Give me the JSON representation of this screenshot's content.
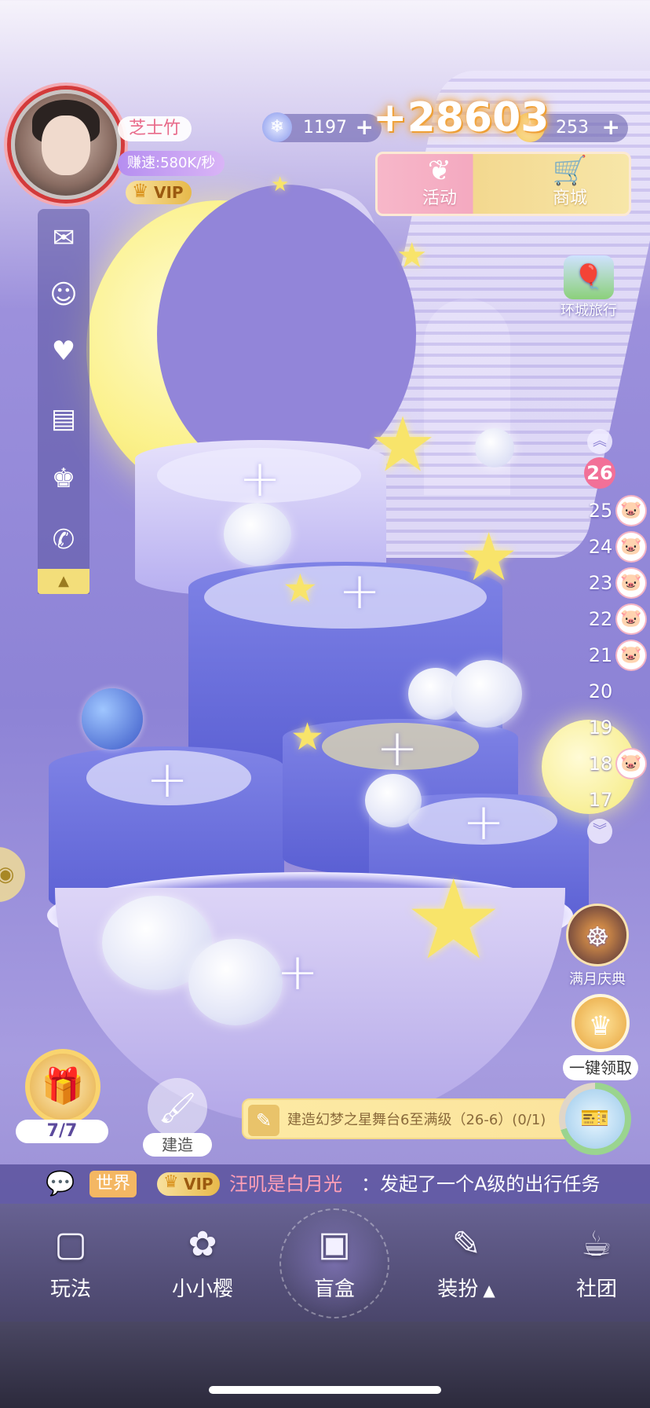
{
  "profile": {
    "name": "芝士竹",
    "speed": "赚速:580K/秒",
    "vip": "VIP"
  },
  "currency": {
    "gems": {
      "icon": "snowflake-gem-icon",
      "value": "1197",
      "plus": "+"
    },
    "stars": {
      "icon": "star-icon",
      "value": "253",
      "plus": "+"
    },
    "gain": "+28603"
  },
  "top_buttons": {
    "activity": "活动",
    "shop": "商城",
    "city_travel": "环城旅行"
  },
  "sidebar": {
    "icons": [
      "mail-icon",
      "friends-icon",
      "pet-icon",
      "notice-board-icon",
      "trophy-icon",
      "wechat-icon"
    ],
    "toggle": "▲"
  },
  "floors": {
    "up": "︽",
    "current": "26",
    "levels": [
      "25",
      "24",
      "23",
      "22",
      "21",
      "20",
      "19",
      "18",
      "17"
    ],
    "down": "︾"
  },
  "events": {
    "full_moon": "满月庆典",
    "claim_all": "一键领取"
  },
  "actions": {
    "gift_count": "7/7",
    "build": "建造",
    "task": "建造幻梦之星舞台6至满级（26-6）(0/1)"
  },
  "chat": {
    "channel": "世界",
    "vip": "VIP",
    "user": "汪叽是白月光",
    "message": "：发起了一个A级的出行任务"
  },
  "nav": [
    {
      "label": "玩法",
      "icon": "card-icon"
    },
    {
      "label": "小小樱",
      "icon": "sakura-icon"
    },
    {
      "label": "盲盒",
      "icon": "blind-box-icon"
    },
    {
      "label": "装扮",
      "icon": "brush-icon"
    },
    {
      "label": "社团",
      "icon": "cup-icon"
    }
  ],
  "colors": {
    "background": "#8d83d6",
    "moon": "#fbf18b",
    "accent_pink": "#f27098",
    "accent_gold": "#f3de7a"
  }
}
